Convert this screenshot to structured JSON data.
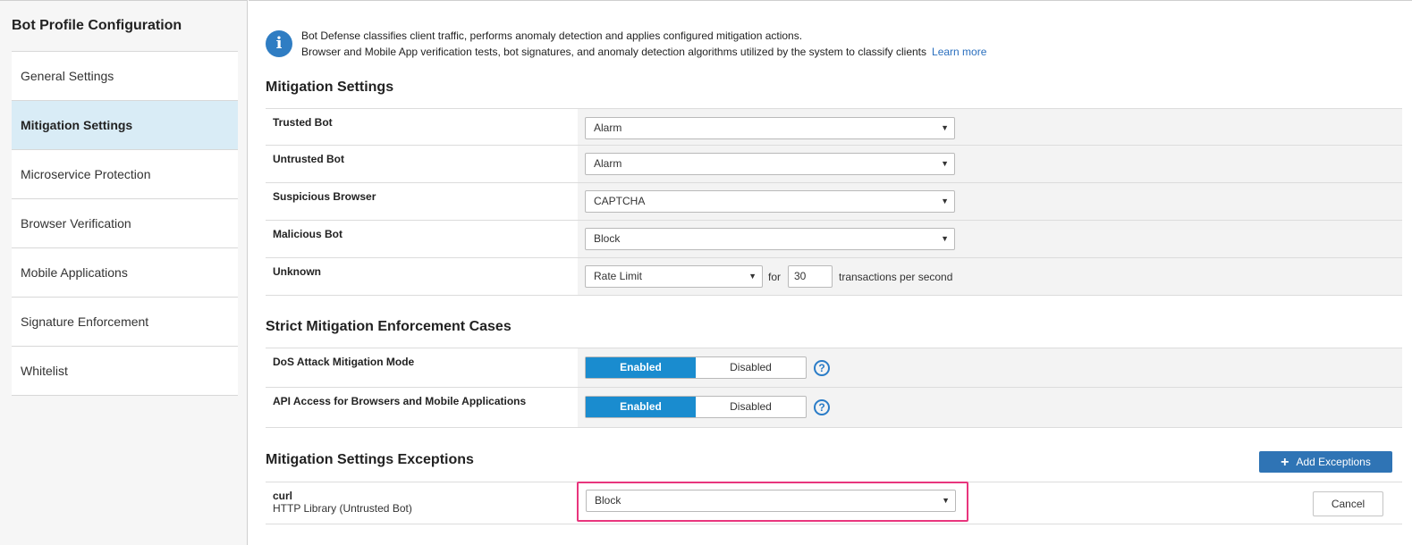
{
  "sidebar": {
    "title": "Bot Profile Configuration",
    "items": [
      {
        "label": "General Settings"
      },
      {
        "label": "Mitigation Settings"
      },
      {
        "label": "Microservice Protection"
      },
      {
        "label": "Browser Verification"
      },
      {
        "label": "Mobile Applications"
      },
      {
        "label": "Signature Enforcement"
      },
      {
        "label": "Whitelist"
      }
    ],
    "active_index": 1
  },
  "info": {
    "icon": "info-icon",
    "line1": "Bot Defense classifies client traffic, performs anomaly detection and applies configured mitigation actions.",
    "line2": "Browser and Mobile App verification tests, bot signatures, and anomaly detection algorithms utilized by the system to classify clients",
    "learn_more": "Learn more"
  },
  "mitigation": {
    "title": "Mitigation Settings",
    "rows": [
      {
        "label": "Trusted Bot",
        "value": "Alarm"
      },
      {
        "label": "Untrusted Bot",
        "value": "Alarm"
      },
      {
        "label": "Suspicious Browser",
        "value": "CAPTCHA"
      },
      {
        "label": "Malicious Bot",
        "value": "Block"
      },
      {
        "label": "Unknown",
        "value": "Rate Limit",
        "for_label": "for",
        "rate": "30",
        "unit": "transactions per second"
      }
    ]
  },
  "strict": {
    "title": "Strict Mitigation Enforcement Cases",
    "rows": [
      {
        "label": "DoS Attack Mitigation Mode",
        "enabled": "Enabled",
        "disabled": "Disabled"
      },
      {
        "label": "API Access for Browsers and Mobile Applications",
        "enabled": "Enabled",
        "disabled": "Disabled"
      }
    ],
    "help_glyph": "?"
  },
  "exceptions": {
    "title": "Mitigation Settings Exceptions",
    "add_label": "Add Exceptions",
    "rows": [
      {
        "name": "curl",
        "sub": "HTTP Library (Untrusted Bot)",
        "value": "Block",
        "cancel": "Cancel"
      }
    ]
  },
  "colors": {
    "accent": "#1a8ccf",
    "button_primary": "#2f74b5",
    "highlight": "#e8357d",
    "active_nav": "#d9ecf6"
  }
}
